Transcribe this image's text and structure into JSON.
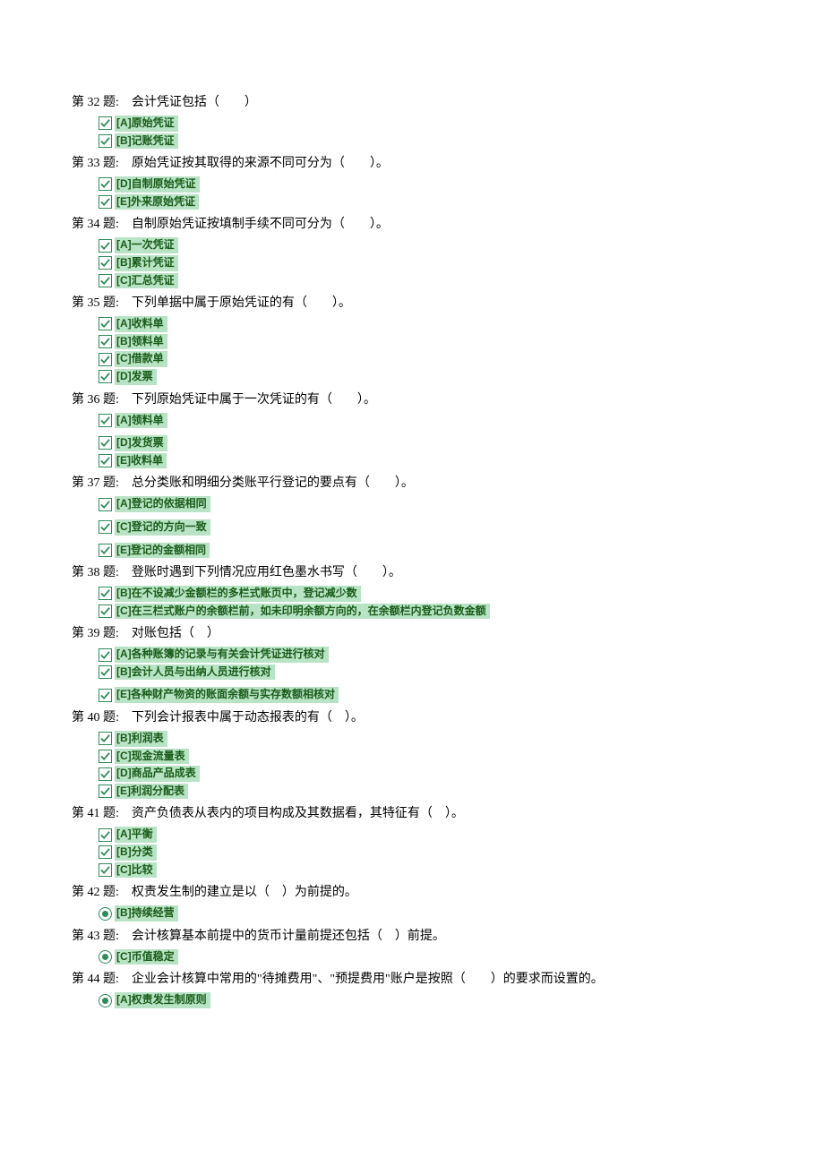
{
  "questions": [
    {
      "number": "第 32 题:",
      "text": "会计凭证包括（　　）",
      "type": "checkbox",
      "options": [
        "[A]原始凭证",
        "[B]记账凭证"
      ]
    },
    {
      "number": "第 33 题:",
      "text": "原始凭证按其取得的来源不同可分为（　　）。",
      "type": "checkbox",
      "options": [
        "[D]自制原始凭证",
        "[E]外来原始凭证"
      ]
    },
    {
      "number": "第 34 题:",
      "text": "自制原始凭证按填制手续不同可分为（　　）。",
      "type": "checkbox",
      "options": [
        "[A]一次凭证",
        "[B]累计凭证",
        "[C]汇总凭证"
      ]
    },
    {
      "number": "第 35 题:",
      "text": "下列单据中属于原始凭证的有（　　）。",
      "type": "checkbox",
      "options": [
        "[A]收料单",
        "[B]领料单",
        "[C]借款单",
        "[D]发票"
      ]
    },
    {
      "number": "第 36 题:",
      "text": "下列原始凭证中属于一次凭证的有（　　）。",
      "type": "checkbox",
      "options": [
        "[A]领料单",
        "",
        "[D]发货票",
        "[E]收料单"
      ]
    },
    {
      "number": "第 37 题:",
      "text": "总分类账和明细分类账平行登记的要点有（　　）。",
      "type": "checkbox",
      "options": [
        "[A]登记的依据相同",
        "",
        "[C]登记的方向一致",
        "",
        "[E]登记的金额相同"
      ]
    },
    {
      "number": "第 38 题:",
      "text": "登账时遇到下列情况应用红色墨水书写（　　）。",
      "type": "checkbox",
      "options": [
        "[B]在不设减少金额栏的多栏式账页中，登记减少数",
        "[C]在三栏式账户的余额栏前，如未印明余额方向的，在余额栏内登记负数金额"
      ]
    },
    {
      "number": "第 39 题:",
      "text": "对账包括（　）",
      "type": "checkbox",
      "options": [
        "[A]各种账簿的记录与有关会计凭证进行核对",
        "[B]会计人员与出纳人员进行核对",
        "",
        "[E]各种财产物资的账面余额与实存数额相核对"
      ]
    },
    {
      "number": "第 40 题:",
      "text": "下列会计报表中属于动态报表的有（　）。",
      "type": "checkbox",
      "options": [
        "[B]利润表",
        "[C]现金流量表",
        "[D]商品产品成表",
        "[E]利润分配表"
      ]
    },
    {
      "number": "第 41 题:",
      "text": "资产负债表从表内的项目构成及其数据看，其特征有（　）。",
      "type": "checkbox",
      "options": [
        "[A]平衡",
        "[B]分类",
        "[C]比较"
      ]
    },
    {
      "number": "第 42 题:",
      "text": "权责发生制的建立是以（　）为前提的。",
      "type": "radio",
      "options": [
        "[B]持续经营"
      ]
    },
    {
      "number": "第 43 题:",
      "text": "会计核算基本前提中的货币计量前提还包括（　）前提。",
      "type": "radio",
      "options": [
        "[C]币值稳定"
      ]
    },
    {
      "number": "第 44 题:",
      "text": "企业会计核算中常用的\"待摊费用\"、\"预提费用\"账户是按照（　　）的要求而设置的。",
      "type": "radio",
      "options": [
        "[A]权责发生制原则"
      ]
    }
  ]
}
